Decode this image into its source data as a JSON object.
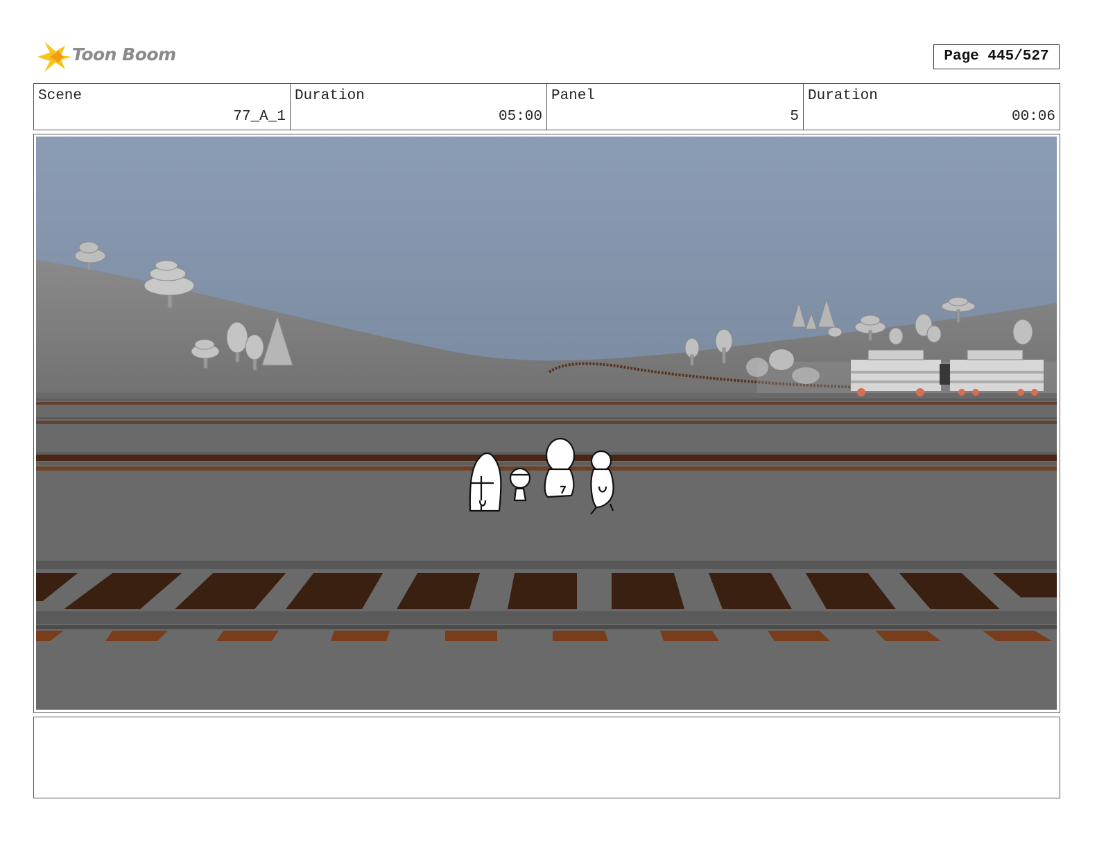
{
  "header": {
    "logo_text": "Toon Boom",
    "page_label": "Page 445/527"
  },
  "info": [
    {
      "label": "Scene",
      "value": "77_A_1"
    },
    {
      "label": "Duration",
      "value": "05:00"
    },
    {
      "label": "Panel",
      "value": "5"
    },
    {
      "label": "Duration",
      "value": "00:06"
    }
  ],
  "panel": {
    "description": "",
    "colors": {
      "sky_top": "#8a9cb3",
      "sky_bottom": "#6b7a8f",
      "ground": "#6a6a6a",
      "rail": "#585858",
      "tie": "#3d2212",
      "tie_edge": "#7a3d1c"
    }
  },
  "notes": {
    "text": ""
  }
}
